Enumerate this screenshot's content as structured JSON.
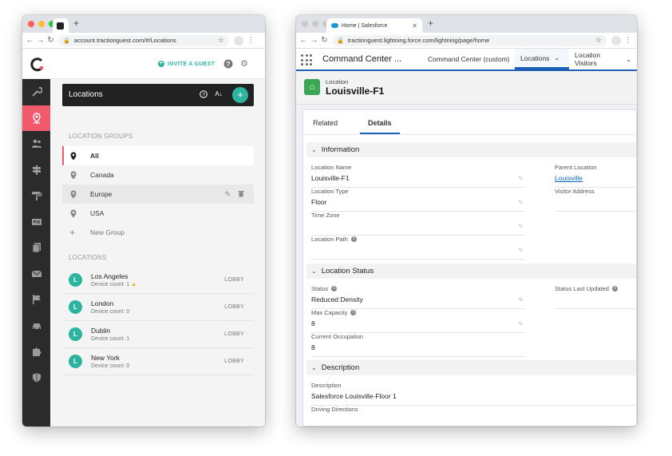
{
  "colors": {
    "accent_pink": "#f05a6a",
    "accent_teal": "#2bb5a0",
    "sf_blue": "#1b5fb8",
    "sf_green": "#3ba755"
  },
  "traction": {
    "address": "account.tractionguest.com/#/Locations",
    "invite_label": "INVITE A GUEST",
    "header_title": "Locations",
    "groups_heading": "LOCATION GROUPS",
    "groups": [
      {
        "label": "All"
      },
      {
        "label": "Canada"
      },
      {
        "label": "Europe"
      },
      {
        "label": "USA"
      }
    ],
    "new_group_label": "New Group",
    "locations_heading": "LOCATIONS",
    "locations": [
      {
        "initial": "L",
        "name": "Los Angeles",
        "count": "Device count: 1",
        "tag": "LOBBY",
        "warning": true
      },
      {
        "initial": "L",
        "name": "London",
        "count": "Device count: 0",
        "tag": "LOBBY",
        "warning": false
      },
      {
        "initial": "L",
        "name": "Dublin",
        "count": "Device count: 1",
        "tag": "LOBBY",
        "warning": false
      },
      {
        "initial": "L",
        "name": "New York",
        "count": "Device count: 0",
        "tag": "LOBBY",
        "warning": false
      }
    ],
    "sidebar_icons": [
      "wrench-icon",
      "location-pin-icon",
      "users-icon",
      "signpost-icon",
      "paint-roller-icon",
      "id-card-icon",
      "documents-icon",
      "mail-icon",
      "flag-icon",
      "car-icon",
      "puzzle-icon",
      "shield-icon"
    ]
  },
  "salesforce": {
    "tab_title": "Home | Salesforce",
    "address": "tractionguest.lightning.force.com/lightning/page/home",
    "app_name": "Command Center ...",
    "nav_tabs": [
      "Command Center (custom)",
      "Locations",
      "Location Visitors"
    ],
    "record_type": "Location",
    "record_title": "Louisville-F1",
    "sub_tabs": [
      "Related",
      "Details"
    ],
    "sections": {
      "information": "Information",
      "status": "Location Status",
      "description": "Description"
    },
    "fields": {
      "location_name": {
        "label": "Location Name",
        "value": "Louisville-F1"
      },
      "location_type": {
        "label": "Location Type",
        "value": "Floor"
      },
      "time_zone": {
        "label": "Time Zone",
        "value": ""
      },
      "location_path": {
        "label": "Location Path",
        "value": ""
      },
      "parent_location": {
        "label": "Parent Location",
        "value": "Louisville"
      },
      "visitor_address": {
        "label": "Visitor Address",
        "value": ""
      },
      "status": {
        "label": "Status",
        "value": "Reduced Density"
      },
      "status_last_updated": {
        "label": "Status Last Updated",
        "value": ""
      },
      "max_capacity": {
        "label": "Max Capacity",
        "value": "8"
      },
      "current_occupation": {
        "label": "Current Occupation",
        "value": "8"
      },
      "description": {
        "label": "Description",
        "value": "Salesforce Louisville-Floor 1"
      },
      "driving_directions": {
        "label": "Driving Directions",
        "value": ""
      }
    }
  }
}
